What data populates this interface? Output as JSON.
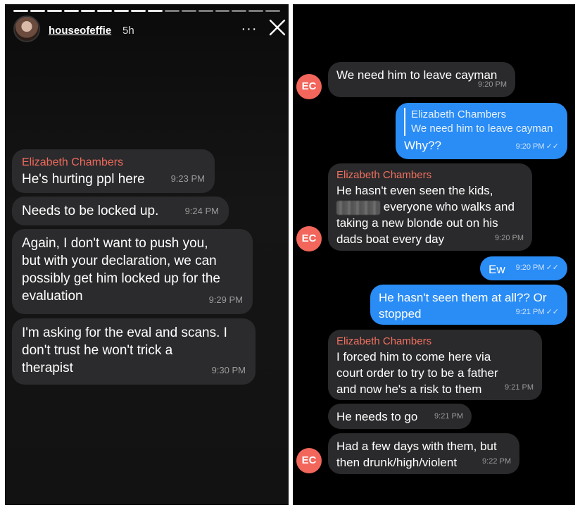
{
  "story": {
    "username": "houseofeffie",
    "time_ago": "5h",
    "more_label": "···",
    "close_icon": "close-icon",
    "messages": [
      {
        "sender": "Elizabeth Chambers",
        "text": "He's hurting ppl here",
        "time": "9:23 PM"
      },
      {
        "text": "Needs to be locked up.",
        "time": "9:24 PM"
      },
      {
        "text": "Again, I don't want to push you,\nbut with your declaration, we can\npossibly get him locked up for the\nevaluation",
        "time": "9:29 PM"
      },
      {
        "text": "I'm asking for the eval and scans. I\ndon't trust he won't trick a\ntherapist",
        "time": "9:30 PM"
      }
    ]
  },
  "chat": {
    "avatar_initials": "EC",
    "colors": {
      "incoming": "#2a2a2c",
      "outgoing": "#2a8cf5",
      "sender_name": "#f0705f",
      "avatar": "#f2665b"
    },
    "messages": [
      {
        "text": "We need him to leave cayman",
        "time": "9:20 PM"
      },
      {
        "quote": "We need him to leave cayman",
        "text": "Why??",
        "time": "9:20 PM",
        "read": "✓✓"
      },
      {
        "sender": "Elizabeth Chambers",
        "text_before": "He hasn't even seen the kids,",
        "text_after": "everyone who walks and\ntaking a new blonde out on his\ndads boat every day",
        "time": "9:20 PM"
      },
      {
        "text": "Ew",
        "time": "9:20 PM",
        "read": "✓✓"
      },
      {
        "text": "He hasn't seen them at all?? Or\nstopped",
        "time": "9:21 PM",
        "read": "✓✓"
      },
      {
        "sender": "Elizabeth Chambers",
        "text": "I forced him to come here via\ncourt order to try to be a father\nand now he's a risk to them",
        "time": "9:21 PM"
      },
      {
        "text": "He needs to go",
        "time": "9:21 PM"
      },
      {
        "text": "Had a few days with them, but\nthen drunk/high/violent",
        "time": "9:22 PM"
      }
    ]
  }
}
